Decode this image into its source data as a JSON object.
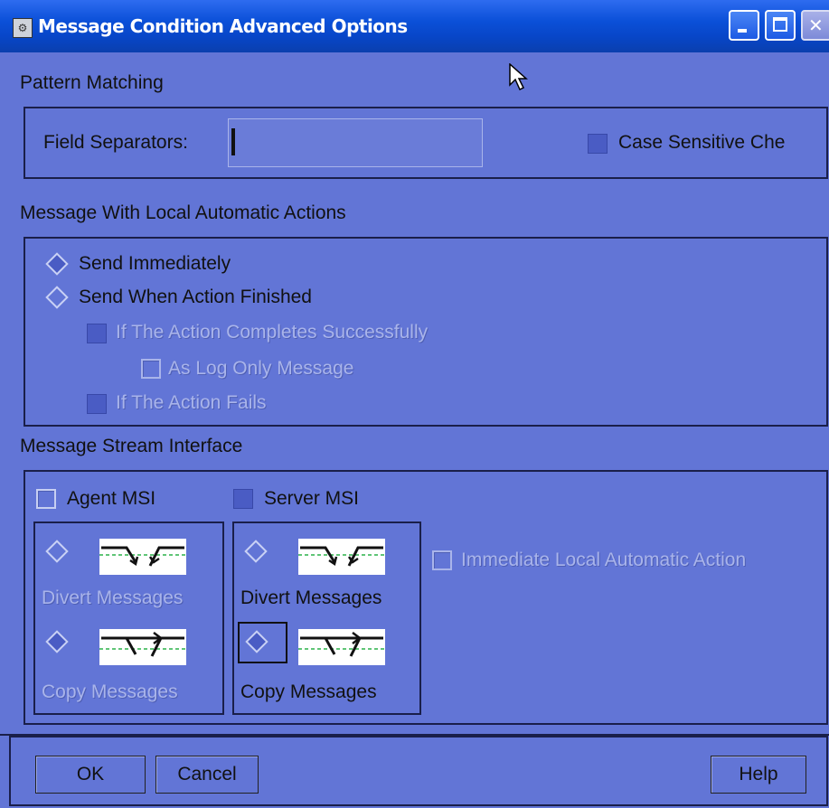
{
  "window": {
    "title": "Message Condition Advanced Options",
    "icon": "app-icon",
    "controls": {
      "minimize": "minimize-icon",
      "maximize": "maximize-icon",
      "close": "close-icon"
    }
  },
  "pattern_matching": {
    "label": "Pattern Matching",
    "field_separators_label": "Field Separators:",
    "field_separators_value": "",
    "case_sensitive_label": "Case Sensitive Che"
  },
  "local_actions": {
    "label": "Message With Local Automatic Actions",
    "send_immediately": "Send Immediately",
    "send_when_finished": "Send When Action Finished",
    "if_completes": "If The Action Completes Successfully",
    "as_log_only": "As Log Only Message",
    "if_fails": "If The Action Fails"
  },
  "msi": {
    "label": "Message Stream Interface",
    "agent_msi": "Agent MSI",
    "server_msi": "Server MSI",
    "agent_divert": "Divert Messages",
    "agent_copy": "Copy Messages",
    "server_divert": "Divert Messages",
    "server_copy": "Copy Messages",
    "immediate_local": "Immediate Local Automatic Action"
  },
  "buttons": {
    "ok": "OK",
    "cancel": "Cancel",
    "help": "Help"
  },
  "colors": {
    "window_bg": "#6275d6",
    "titlebar": "#0b50d8",
    "disabled_text": "#a9b4ea"
  }
}
